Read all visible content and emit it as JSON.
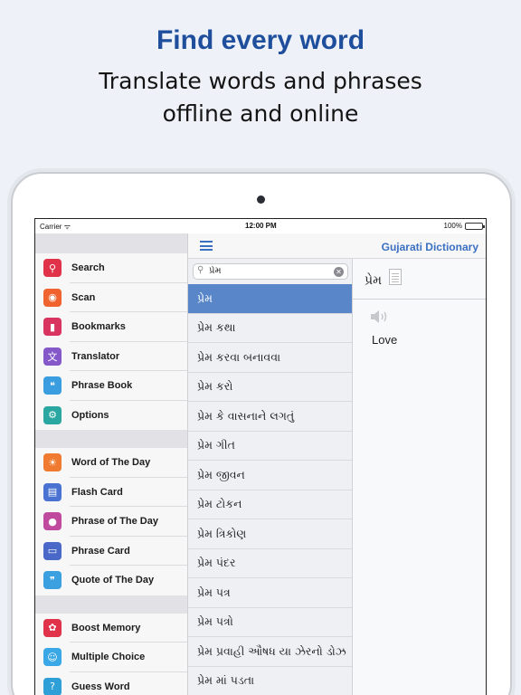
{
  "promo": {
    "headline": "Find every word",
    "subline1": "Translate words and phrases",
    "subline2": "offline and online"
  },
  "status_bar": {
    "carrier": "Carrier",
    "time": "12:00 PM",
    "battery": "100%"
  },
  "nav": {
    "title": "Gujarati Dictionary"
  },
  "sidebar": {
    "groups": [
      [
        {
          "label": "Search",
          "icon": "search-icon",
          "color": "#e0334a"
        },
        {
          "label": "Scan",
          "icon": "camera-icon",
          "color": "#f0632f"
        },
        {
          "label": "Bookmarks",
          "icon": "bookmark-icon",
          "color": "#d8345f"
        },
        {
          "label": "Translator",
          "icon": "translate-icon",
          "color": "#8458c9"
        },
        {
          "label": "Phrase Book",
          "icon": "phrase-book-icon",
          "color": "#3a9de0"
        },
        {
          "label": "Options",
          "icon": "gear-icon",
          "color": "#2aa7a0"
        }
      ],
      [
        {
          "label": "Word of The Day",
          "icon": "sun-icon",
          "color": "#f07a2f"
        },
        {
          "label": "Flash Card",
          "icon": "flash-card-icon",
          "color": "#4a72d2"
        },
        {
          "label": "Phrase of The Day",
          "icon": "chat-bubble-icon",
          "color": "#c04b9e"
        },
        {
          "label": "Phrase Card",
          "icon": "card-icon",
          "color": "#4a68c8"
        },
        {
          "label": "Quote of The Day",
          "icon": "quote-icon",
          "color": "#3aa0e0"
        }
      ],
      [
        {
          "label": "Boost Memory",
          "icon": "brain-icon",
          "color": "#e0334a"
        },
        {
          "label": "Multiple Choice",
          "icon": "people-icon",
          "color": "#3aa8e6"
        },
        {
          "label": "Guess Word",
          "icon": "question-icon",
          "color": "#2f9fd8"
        }
      ]
    ]
  },
  "search": {
    "value": "પ્રેમ"
  },
  "word_list": [
    "પ્રેમ",
    "પ્રેમ કથા",
    "પ્રેમ કરવા બનાવવા",
    "પ્રેમ કરો",
    "પ્રેમ કે વાસનાને લગતું",
    "પ્રેમ ગીત",
    "પ્રેમ જીવન",
    "પ્રેમ ટોકન",
    "પ્રેમ ત્રિકોણ",
    "પ્રેમ પંદર",
    "પ્રેમ પત્ર",
    "પ્રેમ પત્રો",
    "પ્રેમ પ્રવાહી ઔષધ યા ઝેરનો ડોઝ",
    "પ્રેમ માં પડતા"
  ],
  "selected_index": 0,
  "detail": {
    "word": "પ્રેમ",
    "meaning": "Love"
  }
}
